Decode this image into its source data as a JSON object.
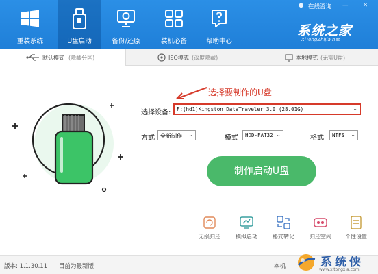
{
  "header": {
    "nav": [
      {
        "label": "重装系统",
        "icon": "windows-icon"
      },
      {
        "label": "U盘启动",
        "icon": "usb-drive-icon",
        "active": true
      },
      {
        "label": "备份/还原",
        "icon": "monitor-backup-icon"
      },
      {
        "label": "装机必备",
        "icon": "apps-grid-icon"
      },
      {
        "label": "帮助中心",
        "icon": "help-icon"
      }
    ],
    "top_tools": {
      "online_consult": "在线咨询",
      "minimize": "—",
      "close": "✕"
    },
    "brand": {
      "title": "系统之家",
      "url": "XiTongZhiJia.net"
    }
  },
  "tabs": [
    {
      "label": "默认模式",
      "note": "(隐藏分区)",
      "active": true
    },
    {
      "label": "ISO模式",
      "note": "(深度隐藏)"
    },
    {
      "label": "本地模式",
      "note": "(无需U盘)"
    }
  ],
  "annotation": "选择要制作的U盘",
  "form": {
    "device_label": "选择设备:",
    "device_value": "F:(hd1)Kingston DataTraveler 3.0 (28.01G)",
    "method_label": "方式",
    "method_value": "全新制作",
    "mode_label": "模式",
    "mode_value": "HDD-FAT32",
    "format_label": "格式",
    "format_value": "NTFS"
  },
  "start_button": "制作启动U盘",
  "tools": [
    {
      "label": "无损归还",
      "icon": "restore-icon"
    },
    {
      "label": "模拟启动",
      "icon": "simulate-boot-icon"
    },
    {
      "label": "格式转化",
      "icon": "format-convert-icon"
    },
    {
      "label": "归还空间",
      "icon": "reclaim-space-icon"
    },
    {
      "label": "个性设置",
      "icon": "custom-settings-icon"
    }
  ],
  "status": {
    "version": "版本: 1.1.30.11",
    "update": "目前为最新版",
    "right_text": "本机"
  },
  "watermark": {
    "text": "系统侠",
    "url": "www.xitongxia.com"
  },
  "colors": {
    "header_blue": "#2088de",
    "accent_green": "#4ab96a",
    "alert_red": "#d63a2a"
  }
}
